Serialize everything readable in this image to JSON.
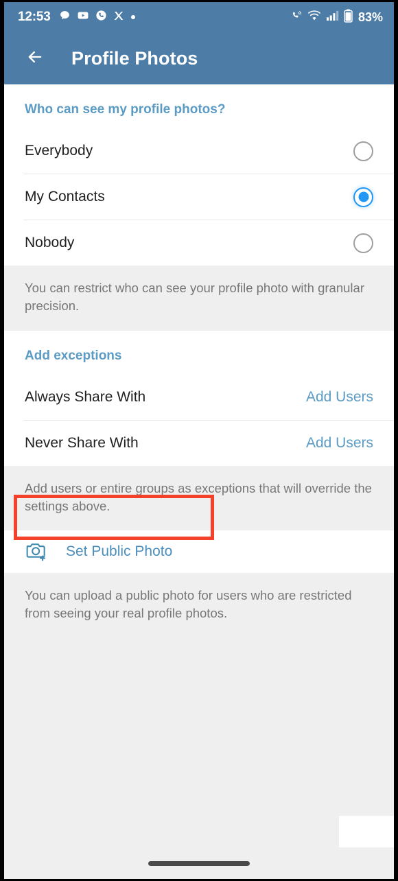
{
  "status_bar": {
    "time": "12:53",
    "battery_percent": "83%",
    "left_icons": [
      "chat-bubble-icon",
      "youtube-icon",
      "phone-circle-icon",
      "x-twitter-icon",
      "dot-icon"
    ],
    "right_icons": [
      "call-sound-icon",
      "wifi-icon",
      "signal-bars-icon",
      "battery-icon"
    ]
  },
  "app_bar": {
    "title": "Profile Photos",
    "back_icon": "arrow-left-icon"
  },
  "visibility_section": {
    "header": "Who can see my profile photos?",
    "options": [
      {
        "label": "Everybody",
        "selected": false
      },
      {
        "label": "My Contacts",
        "selected": true
      },
      {
        "label": "Nobody",
        "selected": false
      }
    ],
    "hint": "You can restrict who can see your profile photo with granular precision."
  },
  "exceptions_section": {
    "header": "Add exceptions",
    "rows": [
      {
        "label": "Always Share With",
        "action": "Add Users"
      },
      {
        "label": "Never Share With",
        "action": "Add Users"
      }
    ],
    "hint": "Add users or entire groups as exceptions that will override the settings above."
  },
  "public_photo_section": {
    "label": "Set Public Photo",
    "icon": "camera-plus-icon",
    "hint": "You can upload a public photo for users who are restricted from seeing your real profile photos."
  },
  "colors": {
    "header_blue": "#4d7da6",
    "accent_blue": "#5b9bc4",
    "radio_selected": "#2196f3",
    "annotation_red": "#f4412c",
    "hint_background": "#efefef",
    "hint_text": "#777777"
  }
}
